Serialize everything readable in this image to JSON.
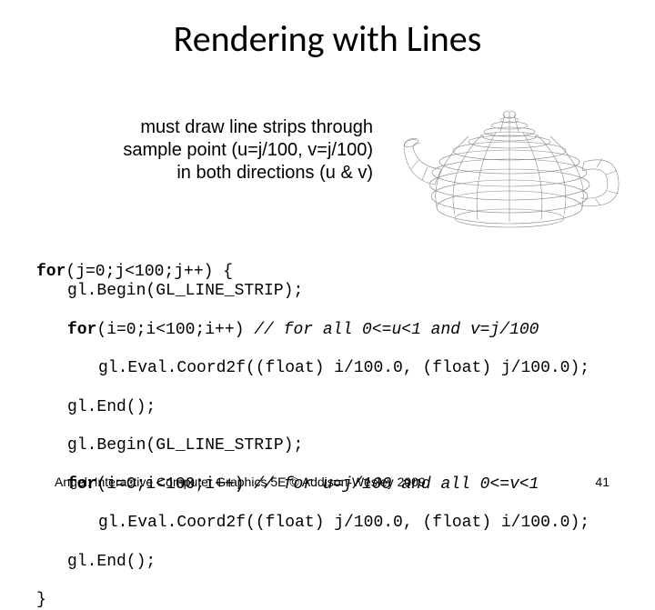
{
  "title": "Rendering with Lines",
  "desc": {
    "l1": "must draw line strips through",
    "l2": "sample point (u=j/100, v=j/100)",
    "l3": "in both directions (u & v)"
  },
  "code": {
    "l1a": "for",
    "l1b": "(j=0;j<100;j++) {",
    "l2": "gl.Begin(GL_LINE_STRIP);",
    "l3a": "for",
    "l3b": "(i=0;i<100;i++) ",
    "l3c": "// for all 0<=u<1 and v=j/100",
    "l4": "gl.Eval.Coord2f((float) i/100.0, (float) j/100.0);",
    "l5": "gl.End();",
    "l6": "gl.Begin(GL_LINE_STRIP);",
    "l7a": "for",
    "l7b": "(i=0;i<100;i++) ",
    "l7c": "// for u=j/100 and all 0<=v<1",
    "l8": "gl.Eval.Coord2f((float) j/100.0, (float) i/100.0);",
    "l9": "gl.End();",
    "l10": "}"
  },
  "footer": "Angel: Interactive Computer Graphics 5E © Addison-Wesley 2009",
  "pagenum": "41"
}
